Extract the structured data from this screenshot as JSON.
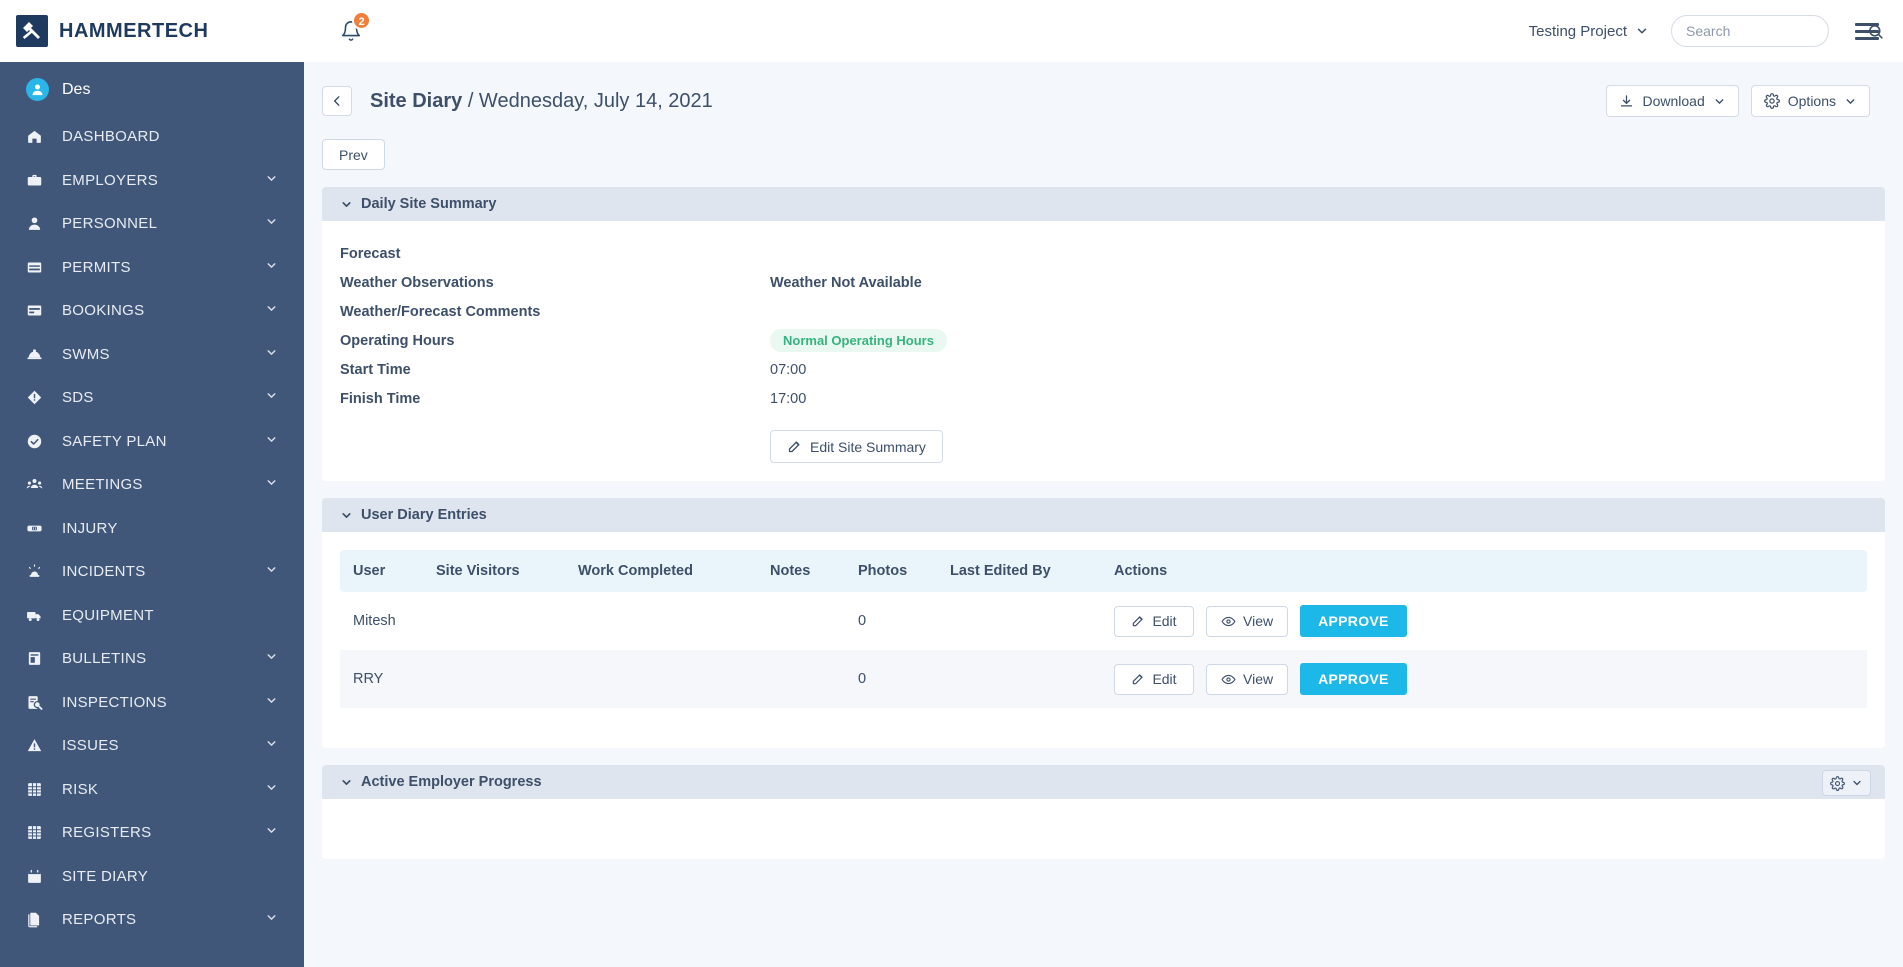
{
  "brand": {
    "name": "HAMMERTECH",
    "logo_icon": "hammer-logo-icon",
    "logo_color": "#1f3a5f"
  },
  "topbar": {
    "notifications_icon": "bell-icon",
    "notifications_count": "2",
    "badge_color": "#f07f3c",
    "project_label": "Testing Project",
    "project_chevron_icon": "chevron-down-icon",
    "search_placeholder": "Search",
    "search_value": "",
    "search_icon": "search-icon",
    "menu_icon": "hamburger-menu-icon"
  },
  "sidebar": {
    "bg_color": "#41577a",
    "user": {
      "name": "Des",
      "avatar_icon": "user-avatar-icon"
    },
    "items": [
      {
        "label": "DASHBOARD",
        "icon": "home-icon",
        "expandable": false
      },
      {
        "label": "EMPLOYERS",
        "icon": "briefcase-icon",
        "expandable": true
      },
      {
        "label": "PERSONNEL",
        "icon": "person-icon",
        "expandable": true
      },
      {
        "label": "PERMITS",
        "icon": "card-icon",
        "expandable": true
      },
      {
        "label": "BOOKINGS",
        "icon": "credit-card-icon",
        "expandable": true
      },
      {
        "label": "SWMS",
        "icon": "hard-hat-icon",
        "expandable": true
      },
      {
        "label": "SDS",
        "icon": "diamond-warning-icon",
        "expandable": true
      },
      {
        "label": "SAFETY PLAN",
        "icon": "check-circle-icon",
        "expandable": true
      },
      {
        "label": "MEETINGS",
        "icon": "people-group-icon",
        "expandable": true
      },
      {
        "label": "INJURY",
        "icon": "bandage-icon",
        "expandable": false
      },
      {
        "label": "INCIDENTS",
        "icon": "siren-icon",
        "expandable": true
      },
      {
        "label": "EQUIPMENT",
        "icon": "truck-icon",
        "expandable": false
      },
      {
        "label": "BULLETINS",
        "icon": "bulletin-board-icon",
        "expandable": true
      },
      {
        "label": "INSPECTIONS",
        "icon": "clipboard-search-icon",
        "expandable": true
      },
      {
        "label": "ISSUES",
        "icon": "warning-triangle-icon",
        "expandable": true
      },
      {
        "label": "RISK",
        "icon": "grid-matrix-icon",
        "expandable": true
      },
      {
        "label": "REGISTERS",
        "icon": "grid-matrix-icon",
        "expandable": true
      },
      {
        "label": "SITE DIARY",
        "icon": "calendar-icon",
        "expandable": false
      },
      {
        "label": "REPORTS",
        "icon": "documents-icon",
        "expandable": true
      }
    ]
  },
  "page": {
    "back_icon": "chevron-left-icon",
    "title_main": "Site Diary",
    "title_rest": " / Wednesday, July 14, 2021",
    "download_label": "Download",
    "download_icon": "download-icon",
    "options_label": "Options",
    "options_icon": "gear-icon",
    "chevron_icon": "chevron-down-icon",
    "prev_label": "Prev"
  },
  "daily_summary": {
    "section_title": "Daily Site Summary",
    "collapse_icon": "chevron-down-icon",
    "rows": [
      {
        "label": "Forecast",
        "value": ""
      },
      {
        "label": "Weather Observations",
        "value": "Weather Not Available"
      },
      {
        "label": "Weather/Forecast Comments",
        "value": ""
      },
      {
        "label": "Operating Hours",
        "value": "Normal Operating Hours"
      },
      {
        "label": "Start Time",
        "value": "07:00"
      },
      {
        "label": "Finish Time",
        "value": "17:00"
      }
    ],
    "operating_hours_badge": "Normal Operating Hours",
    "badge_color": "#36b37e",
    "edit_button_label": "Edit Site Summary",
    "edit_button_icon": "pencil-icon"
  },
  "user_diary_entries": {
    "section_title": "User Diary Entries",
    "collapse_icon": "chevron-down-icon",
    "columns": [
      "User",
      "Site Visitors",
      "Work Completed",
      "Notes",
      "Photos",
      "Last Edited By",
      "Actions"
    ],
    "rows": [
      {
        "user": "Mitesh",
        "site_visitors": "",
        "work_completed": "",
        "notes": "",
        "photos": "0",
        "last_edited_by": ""
      },
      {
        "user": "RRY",
        "site_visitors": "",
        "work_completed": "",
        "notes": "",
        "photos": "0",
        "last_edited_by": ""
      }
    ],
    "edit_label": "Edit",
    "edit_icon": "pencil-icon",
    "view_label": "View",
    "view_icon": "eye-icon",
    "approve_label": "APPROVE",
    "approve_color": "#1cb8e8"
  },
  "active_employer_progress": {
    "section_title": "Active Employer Progress",
    "collapse_icon": "chevron-down-icon",
    "settings_icon": "gear-icon",
    "settings_chevron_icon": "chevron-down-icon"
  }
}
